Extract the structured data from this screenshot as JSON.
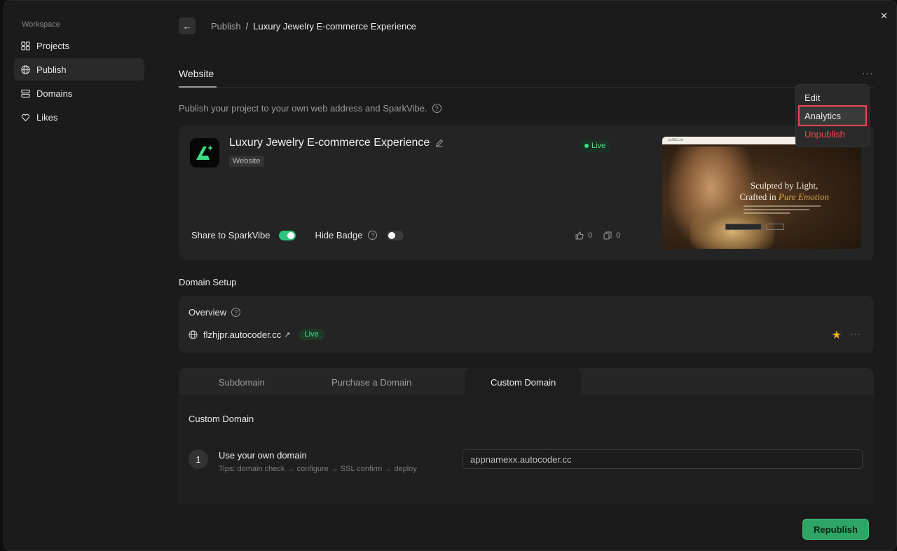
{
  "sidebar": {
    "workspace_label": "Workspace",
    "items": [
      {
        "label": "Projects"
      },
      {
        "label": "Publish"
      },
      {
        "label": "Domains"
      },
      {
        "label": "Likes"
      }
    ]
  },
  "breadcrumb": {
    "parent": "Publish",
    "separator": "/",
    "current": "Luxury Jewelry E-commerce Experience"
  },
  "website": {
    "section_title": "Website",
    "more": "···",
    "description": "Publish your project to your own web address and SparkVibe."
  },
  "menu": {
    "edit": "Edit",
    "analytics": "Analytics",
    "unpublish": "Unpublish"
  },
  "project": {
    "name": "Luxury Jewelry E-commerce Experience",
    "type": "Website",
    "status": "Live",
    "share_label": "Share to SparkVibe",
    "share_on": true,
    "hide_badge_label": "Hide Badge",
    "hide_badge_on": false,
    "likes": "0",
    "copies": "0",
    "preview": {
      "brand": "AURELIA",
      "headline_1": "Sculpted by Light,",
      "headline_2a": "Crafted in ",
      "headline_2b": "Pure Emotion"
    }
  },
  "domain_setup": {
    "title": "Domain Setup",
    "overview_title": "Overview",
    "url": "flzhjpr.autocoder.cc",
    "status": "Live",
    "more": "···"
  },
  "tabs": [
    {
      "label": "Subdomain"
    },
    {
      "label": "Purchase a Domain"
    },
    {
      "label": "Custom Domain"
    }
  ],
  "custom_domain": {
    "title": "Custom Domain",
    "step_number": "1",
    "step_title": "Use your own domain",
    "tip": "Tips: domain check → configure → SSL confirm → deploy",
    "input_value": "appnamexx.autocoder.cc"
  },
  "actions": {
    "republish": "Republish",
    "close": "✕"
  },
  "colors": {
    "accent_green": "#2fa565",
    "live_green": "#4ee08a",
    "danger_red": "#f0474e",
    "highlight_red": "#e5484d",
    "star": "#f5b324"
  }
}
